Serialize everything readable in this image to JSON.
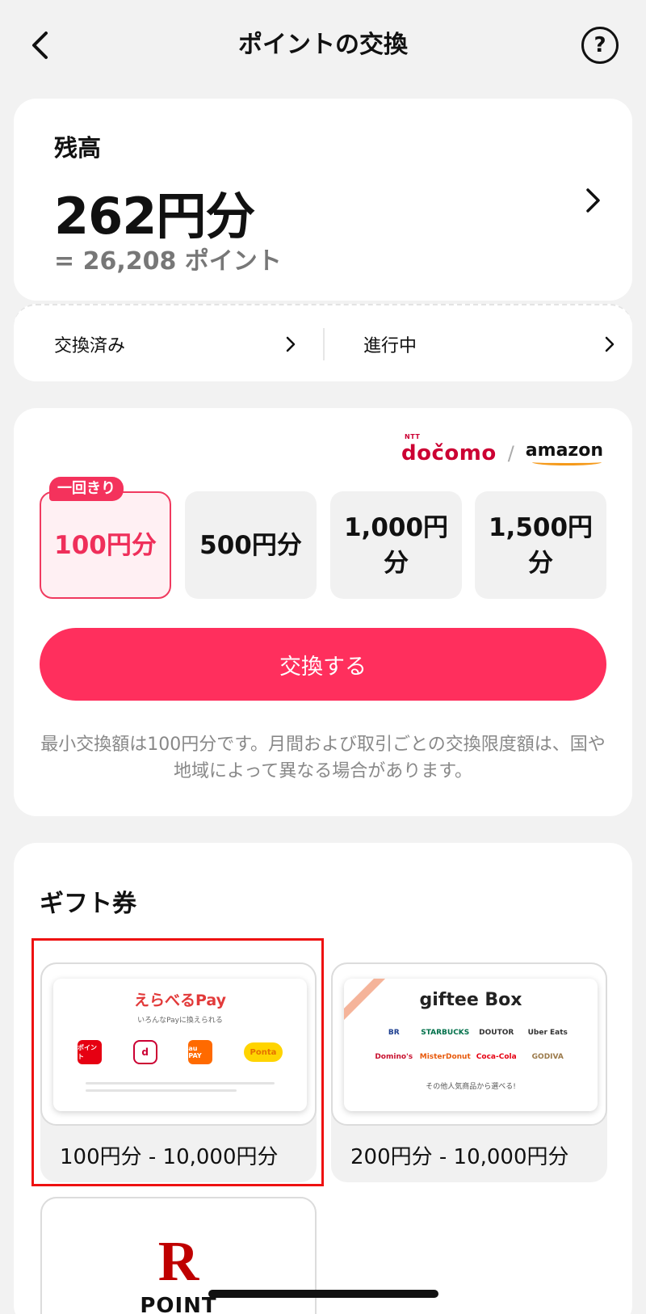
{
  "header": {
    "title": "ポイントの交換"
  },
  "balance": {
    "label": "残高",
    "amount": "262円分",
    "points": "= 26,208 ポイント"
  },
  "status": {
    "done": "交換済み",
    "in_progress": "進行中"
  },
  "exchange": {
    "brand_docomo": "dočomo",
    "brand_ntt": "NTT",
    "brand_amazon": "amazon",
    "badge": "一回きり",
    "options": [
      "100円分",
      "500円分",
      "1,000円\n分",
      "1,500円\n分"
    ],
    "selected_index": 0,
    "button_label": "交換する",
    "note": "最小交換額は100円分です。月間および取引ごとの交換限度額は、国や地域によって異なる場合があります。"
  },
  "gifts": {
    "title": "ギフト券",
    "items": [
      {
        "name": "えらべるPay",
        "subtitle": "いろんなPayに換えられる",
        "range": "100円分 - 10,000円分",
        "logos": [
          "ポイント",
          "d",
          "au PAY",
          "Ponta"
        ]
      },
      {
        "name": "giftee Box",
        "footer": "その他人気商品から選べる!",
        "range": "200円分 - 10,000円分",
        "logos": [
          "BR",
          "STARBUCKS",
          "DOUTOR",
          "Uber Eats",
          "Domino's",
          "MisterDonut",
          "Coca-Cola",
          "GODIVA"
        ]
      },
      {
        "name": "楽天ポイント",
        "logo_r": "R",
        "logo_text": "POINT"
      }
    ]
  },
  "colors": {
    "accent": "#ff2f5d",
    "selected_bg": "#fff0f3",
    "highlight": "#ee1111"
  }
}
